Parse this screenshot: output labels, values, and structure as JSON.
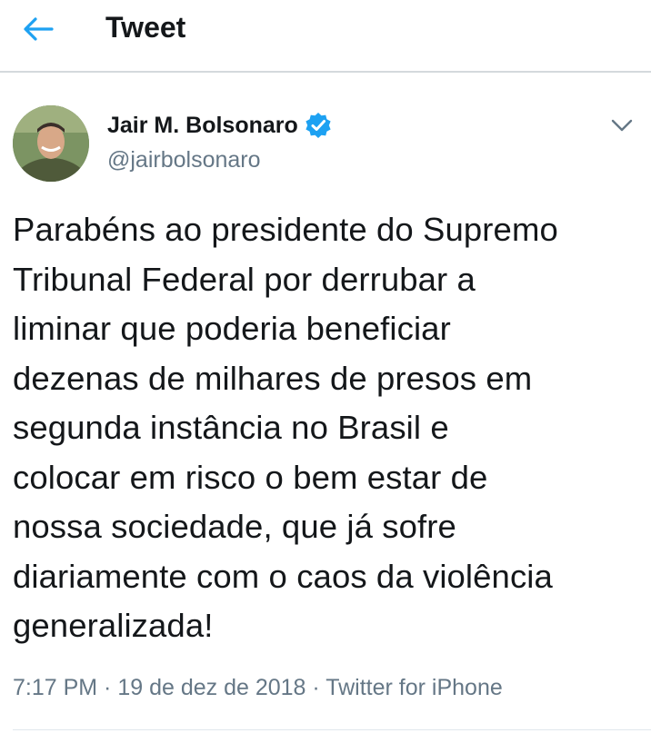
{
  "header": {
    "back_icon": "arrow-left-icon",
    "title": "Tweet"
  },
  "tweet": {
    "author": {
      "name": "Jair M. Bolsonaro",
      "handle": "@jairbolsonaro",
      "verified": true
    },
    "text": "Parabéns ao presidente do Supremo\nTribunal Federal por derrubar a\nliminar que poderia beneficiar\ndezenas de milhares de presos em\nsegunda instância no Brasil e\ncolocar em risco o bem estar de\nnossa sociedade, que já sofre\ndiariamente com o caos da violência\ngeneralizada!",
    "time": "7:17 PM",
    "date": "19 de dez de 2018",
    "source": "Twitter for iPhone",
    "separator": " · "
  },
  "colors": {
    "accent": "#1da1f2",
    "text": "#14171a",
    "secondary_text": "#657786",
    "divider": "#d4d9dd"
  }
}
